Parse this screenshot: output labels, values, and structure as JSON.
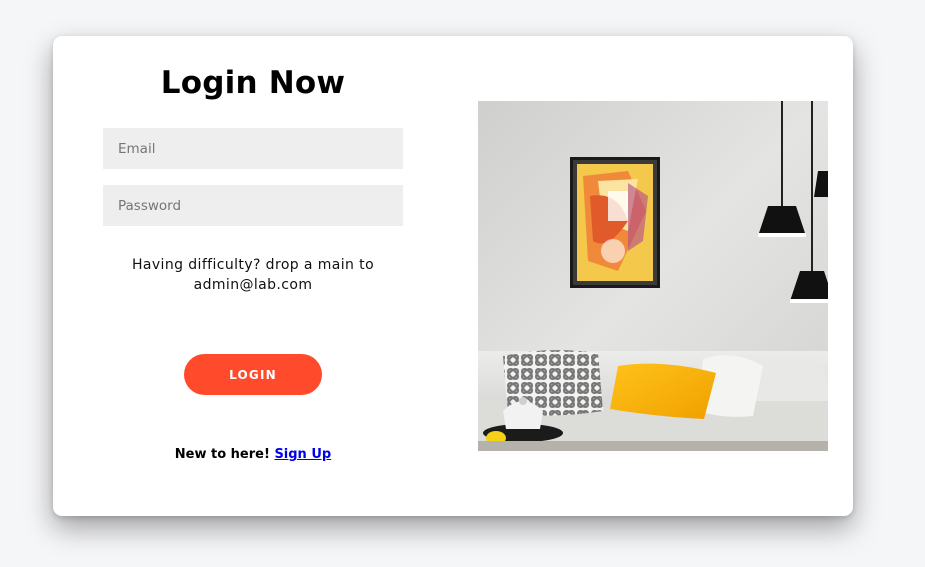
{
  "login": {
    "title": "Login Now",
    "email_placeholder": "Email",
    "password_placeholder": "Password",
    "help_text": "Having difficulty? drop a main to admin@lab.com",
    "login_button": "LOGIN",
    "signup_prompt": "New to here!",
    "signup_link": "Sign Up"
  },
  "colors": {
    "page_background": "#f5f6f8",
    "card_background": "#ffffff",
    "input_background": "#eeeeee",
    "accent": "#ff4b2b",
    "link": "#0000ee"
  }
}
